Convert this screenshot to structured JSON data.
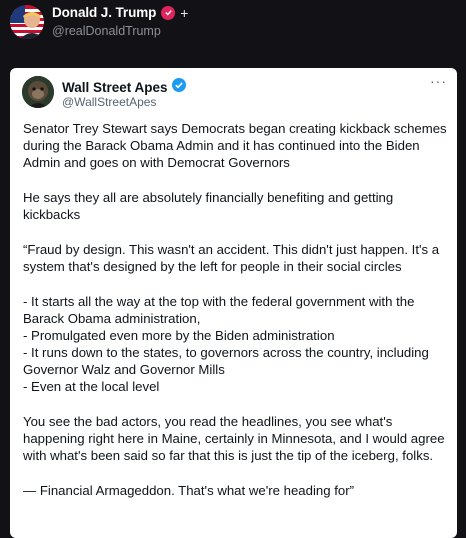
{
  "post": {
    "author_name": "Donald J. Trump",
    "author_handle": "@realDonaldTrump",
    "plus_symbol": "+"
  },
  "quote": {
    "author_name": "Wall Street Apes",
    "author_handle": "@WallStreetApes",
    "more_symbol": "···",
    "paragraphs": [
      "Senator Trey Stewart says Democrats began creating kickback schemes during the Barack Obama Admin and it has continued into the Biden Admin and goes on with Democrat Governors",
      "He says they all are absolutely financially benefiting and getting kickbacks",
      "“Fraud by design. This wasn't an accident. This didn't just happen. It's a system that's designed by the left for people in their social circles"
    ],
    "bullets": [
      "- It starts all the way at the top with the federal government with the Barack Obama administration,",
      "- Promulgated even more by the Biden administration",
      "- It runs down to the states, to governors across the country, including Governor Walz and Governor Mills",
      "- Even at the local level"
    ],
    "closing": [
      "You see the bad actors, you read the headlines, you see what's happening right here in Maine, certainly in Minnesota, and I would agree with what's been said so far that this is just the tip of the iceberg, folks.",
      "— Financial Armageddon. That's what we're heading for”"
    ]
  },
  "colors": {
    "background": "#121216",
    "card": "#ffffff",
    "verified_blue": "#1d9bf0",
    "badge_pink": "#e0245e"
  }
}
